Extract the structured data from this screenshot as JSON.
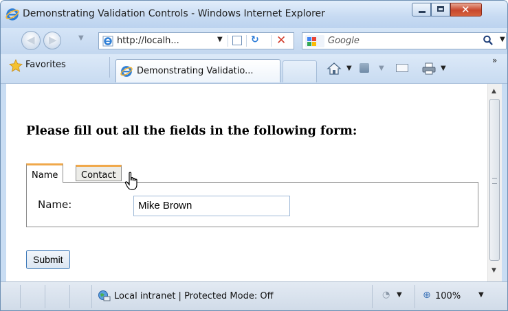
{
  "window": {
    "title": "Demonstrating Validation Controls - Windows Internet Explorer",
    "close_glyph": "✕"
  },
  "nav": {
    "back_glyph": "◀",
    "forward_glyph": "▶",
    "address": "http://localh...",
    "search_placeholder": "Google",
    "dropdown_glyph": "▼",
    "refresh_glyph": "↻",
    "stop_glyph": "✕"
  },
  "command_bar": {
    "favorites_label": "Favorites",
    "active_tab_label": "Demonstrating Validatio...",
    "overflow_glyph": "»"
  },
  "page": {
    "heading": "Please fill out all the fields in the following form:",
    "tabs": [
      {
        "label": "Name",
        "selected": true
      },
      {
        "label": "Contact",
        "selected": false
      }
    ],
    "name_label": "Name:",
    "name_value": "Mike Brown",
    "submit_label": "Submit",
    "tab_accent_color": "#f0a84a"
  },
  "scrollbar": {
    "up_glyph": "▲",
    "down_glyph": "▼"
  },
  "status": {
    "zone_text": "Local intranet | Protected Mode: Off",
    "zoom": "100%",
    "zoom_glyph": "⊕",
    "protected_glyph": "◔"
  }
}
